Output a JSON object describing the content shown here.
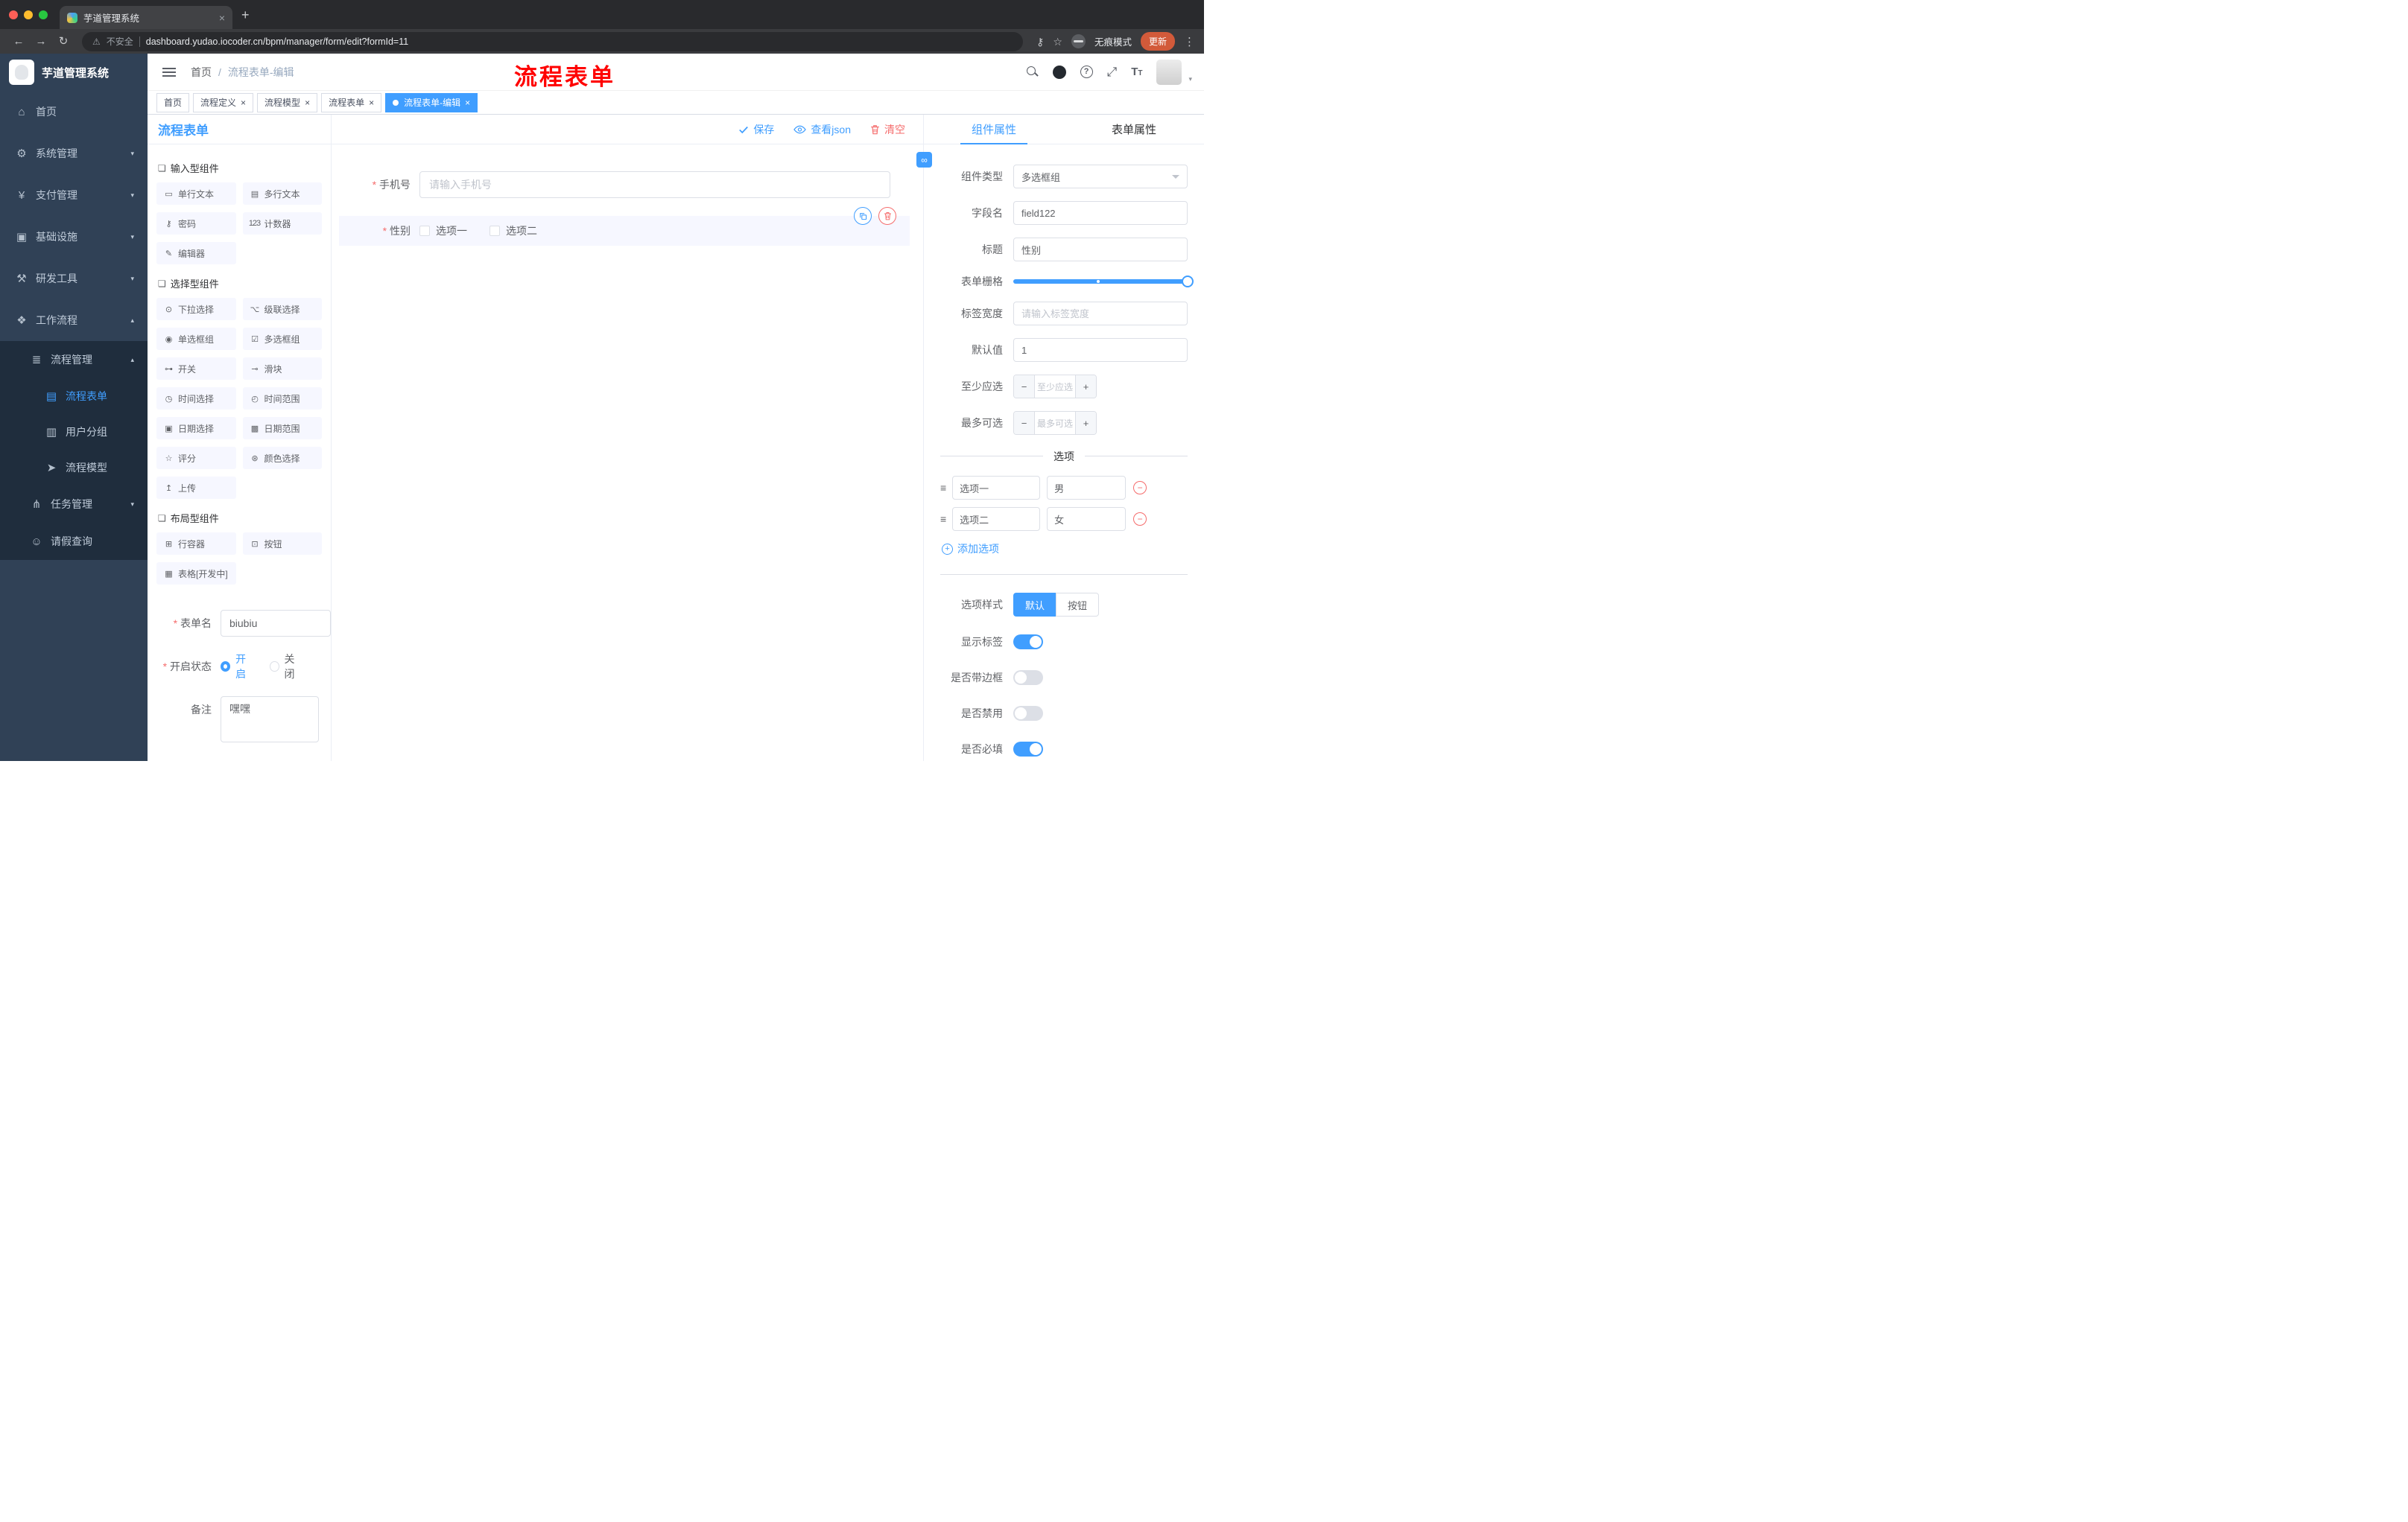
{
  "colors": {
    "primary": "#409EFF",
    "danger": "#F56C6C",
    "overlay_red": "#FF0000",
    "sidebar_bg": "#304156",
    "submenu_bg": "#1F2D3D",
    "update_button": "#D25A3A",
    "tag_active": "#409EFF"
  },
  "browser": {
    "tab_title": "芋道管理系统",
    "security_label": "不安全",
    "url": "dashboard.yudao.iocoder.cn/bpm/manager/form/edit?formId=11",
    "incognito_label": "无痕模式",
    "update_label": "更新"
  },
  "sidebar": {
    "logo_text": "芋道管理系统",
    "items": [
      {
        "label": "首页",
        "icon": "dashboard-icon",
        "glyph": "⌂"
      },
      {
        "label": "系统管理",
        "icon": "system-gear-icon",
        "glyph": "⚙"
      },
      {
        "label": "支付管理",
        "icon": "payment-yen-icon",
        "glyph": "¥"
      },
      {
        "label": "基础设施",
        "icon": "infrastructure-icon",
        "glyph": "▣"
      },
      {
        "label": "研发工具",
        "icon": "devtools-icon",
        "glyph": "⚒"
      },
      {
        "label": "工作流程",
        "icon": "workflow-icon",
        "glyph": "❖"
      },
      {
        "label": "流程管理",
        "icon": "process-manage-icon",
        "glyph": "≣"
      },
      {
        "label": "流程表单",
        "icon": "process-form-icon",
        "glyph": "▤"
      },
      {
        "label": "用户分组",
        "icon": "user-group-icon",
        "glyph": "▥"
      },
      {
        "label": "流程模型",
        "icon": "process-model-icon",
        "glyph": "➤"
      },
      {
        "label": "任务管理",
        "icon": "task-manage-icon",
        "glyph": "⋔"
      },
      {
        "label": "请假查询",
        "icon": "leave-query-icon",
        "glyph": "☺"
      }
    ]
  },
  "header": {
    "breadcrumb_home": "首页",
    "breadcrumb_separator": "/",
    "breadcrumb_current": "流程表单-编辑",
    "overlay_title": "流程表单"
  },
  "tags": {
    "items": [
      {
        "label": "首页",
        "closable": false,
        "active": false
      },
      {
        "label": "流程定义",
        "closable": true,
        "active": false
      },
      {
        "label": "流程模型",
        "closable": true,
        "active": false
      },
      {
        "label": "流程表单",
        "closable": true,
        "active": false
      },
      {
        "label": "流程表单-编辑",
        "closable": true,
        "active": true
      }
    ]
  },
  "designer": {
    "panel_title": "流程表单",
    "actions": {
      "save": "保存",
      "view_json": "查看json",
      "clear": "清空"
    },
    "palette": {
      "sections": [
        {
          "title": "输入型组件",
          "items": [
            {
              "label": "单行文本",
              "icon": "text-input-icon",
              "glyph": "▭"
            },
            {
              "label": "多行文本",
              "icon": "textarea-icon",
              "glyph": "▤"
            },
            {
              "label": "密码",
              "icon": "password-icon",
              "glyph": "⚷"
            },
            {
              "label": "计数器",
              "icon": "counter-icon",
              "glyph": "123"
            },
            {
              "label": "编辑器",
              "icon": "editor-icon",
              "glyph": "✎"
            }
          ]
        },
        {
          "title": "选择型组件",
          "items": [
            {
              "label": "下拉选择",
              "icon": "select-icon",
              "glyph": "⊙"
            },
            {
              "label": "级联选择",
              "icon": "cascader-icon",
              "glyph": "⌥"
            },
            {
              "label": "单选框组",
              "icon": "radio-group-icon",
              "glyph": "◉"
            },
            {
              "label": "多选框组",
              "icon": "checkbox-group-icon",
              "glyph": "☑"
            },
            {
              "label": "开关",
              "icon": "switch-icon",
              "glyph": "⊶"
            },
            {
              "label": "滑块",
              "icon": "slider-icon",
              "glyph": "⊸"
            },
            {
              "label": "时间选择",
              "icon": "time-picker-icon",
              "glyph": "◷"
            },
            {
              "label": "时间范围",
              "icon": "time-range-icon",
              "glyph": "◴"
            },
            {
              "label": "日期选择",
              "icon": "date-picker-icon",
              "glyph": "▣"
            },
            {
              "label": "日期范围",
              "icon": "date-range-icon",
              "glyph": "▩"
            },
            {
              "label": "评分",
              "icon": "rate-icon",
              "glyph": "☆"
            },
            {
              "label": "颜色选择",
              "icon": "color-picker-icon",
              "glyph": "⊛"
            },
            {
              "label": "上传",
              "icon": "upload-icon",
              "glyph": "↥"
            }
          ]
        },
        {
          "title": "布局型组件",
          "items": [
            {
              "label": "行容器",
              "icon": "row-container-icon",
              "glyph": "⊞"
            },
            {
              "label": "按钮",
              "icon": "button-icon",
              "glyph": "⊡"
            },
            {
              "label": "表格[开发中]",
              "icon": "table-icon",
              "glyph": "▦"
            }
          ]
        }
      ]
    },
    "meta": {
      "form_name_label": "表单名",
      "form_name_value": "biubiu",
      "status_label": "开启状态",
      "status_on": "开启",
      "status_off": "关闭",
      "remark_label": "备注",
      "remark_value": "嘿嘿"
    },
    "canvas": {
      "phone": {
        "label": "手机号",
        "placeholder": "请输入手机号"
      },
      "gender": {
        "label": "性别",
        "options": [
          "选项一",
          "选项二"
        ]
      }
    }
  },
  "props": {
    "tab_component": "组件属性",
    "tab_form": "表单属性",
    "component_type_label": "组件类型",
    "component_type_value": "多选框组",
    "field_name_label": "字段名",
    "field_name_value": "field122",
    "title_label": "标题",
    "title_value": "性别",
    "grid_label": "表单栅格",
    "label_width_label": "标签宽度",
    "label_width_placeholder": "请输入标签宽度",
    "default_label": "默认值",
    "default_value": "1",
    "min_label": "至少应选",
    "min_placeholder": "至少应选",
    "max_label": "最多可选",
    "max_placeholder": "最多可选",
    "options_title": "选项",
    "options": [
      {
        "label": "选项一",
        "value": "男"
      },
      {
        "label": "选项二",
        "value": "女"
      }
    ],
    "add_option_label": "添加选项",
    "option_style_label": "选项样式",
    "style_default": "默认",
    "style_button": "按钮",
    "show_label_label": "显示标签",
    "show_label_value": true,
    "border_label": "是否带边框",
    "border_value": false,
    "disabled_label": "是否禁用",
    "disabled_value": false,
    "required_label": "是否必填",
    "required_value": true
  }
}
